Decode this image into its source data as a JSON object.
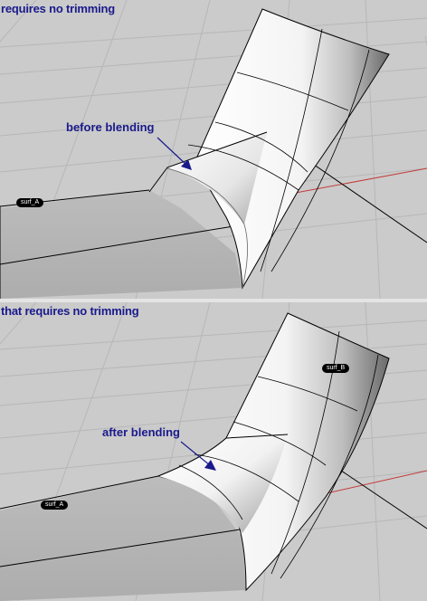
{
  "top_viewport": {
    "caption": "requires no trimming",
    "annotation": "before blending",
    "labels": {
      "surface_a": "surf_A"
    }
  },
  "bottom_viewport": {
    "caption": "that requires no trimming",
    "annotation": "after blending",
    "labels": {
      "surface_a": "surf_A",
      "surface_b": "surf_B"
    }
  },
  "colors": {
    "viewport_bg": "#cbcbcb",
    "grid_line": "#b7b7b7",
    "annotation_text": "#1a1a8c",
    "x_axis": "#c43b3b",
    "surface_edge": "#000000",
    "plane_fill": "#b6b6b6"
  },
  "icons": {
    "arrow": "arrow-icon"
  }
}
